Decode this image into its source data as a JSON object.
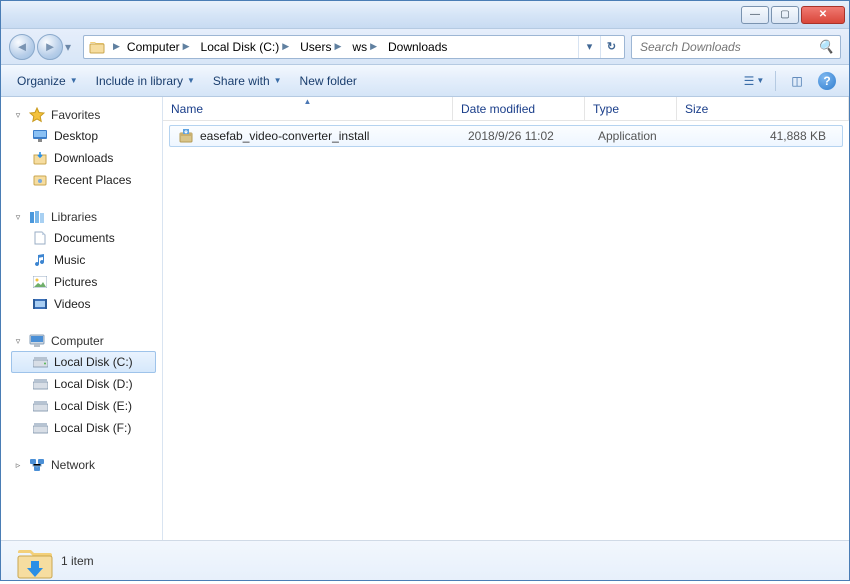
{
  "titlebar": {
    "minimize": "—",
    "maximize": "▢",
    "close": "✕"
  },
  "address": {
    "crumbs": [
      "Computer",
      "Local Disk (C:)",
      "Users",
      "ws",
      "Downloads"
    ]
  },
  "search": {
    "placeholder": "Search Downloads"
  },
  "toolbar": {
    "organize": "Organize",
    "include": "Include in library",
    "share": "Share with",
    "newfolder": "New folder"
  },
  "nav": {
    "favorites": {
      "label": "Favorites",
      "items": [
        "Desktop",
        "Downloads",
        "Recent Places"
      ]
    },
    "libraries": {
      "label": "Libraries",
      "items": [
        "Documents",
        "Music",
        "Pictures",
        "Videos"
      ]
    },
    "computer": {
      "label": "Computer",
      "items": [
        "Local Disk (C:)",
        "Local Disk (D:)",
        "Local Disk (E:)",
        "Local Disk (F:)"
      ],
      "selected_index": 0
    },
    "network": {
      "label": "Network"
    }
  },
  "columns": {
    "name": "Name",
    "date": "Date modified",
    "type": "Type",
    "size": "Size"
  },
  "files": [
    {
      "name": "easefab_video-converter_install",
      "date": "2018/9/26 11:02",
      "type": "Application",
      "size": "41,888 KB"
    }
  ],
  "status": {
    "text": "1 item"
  }
}
